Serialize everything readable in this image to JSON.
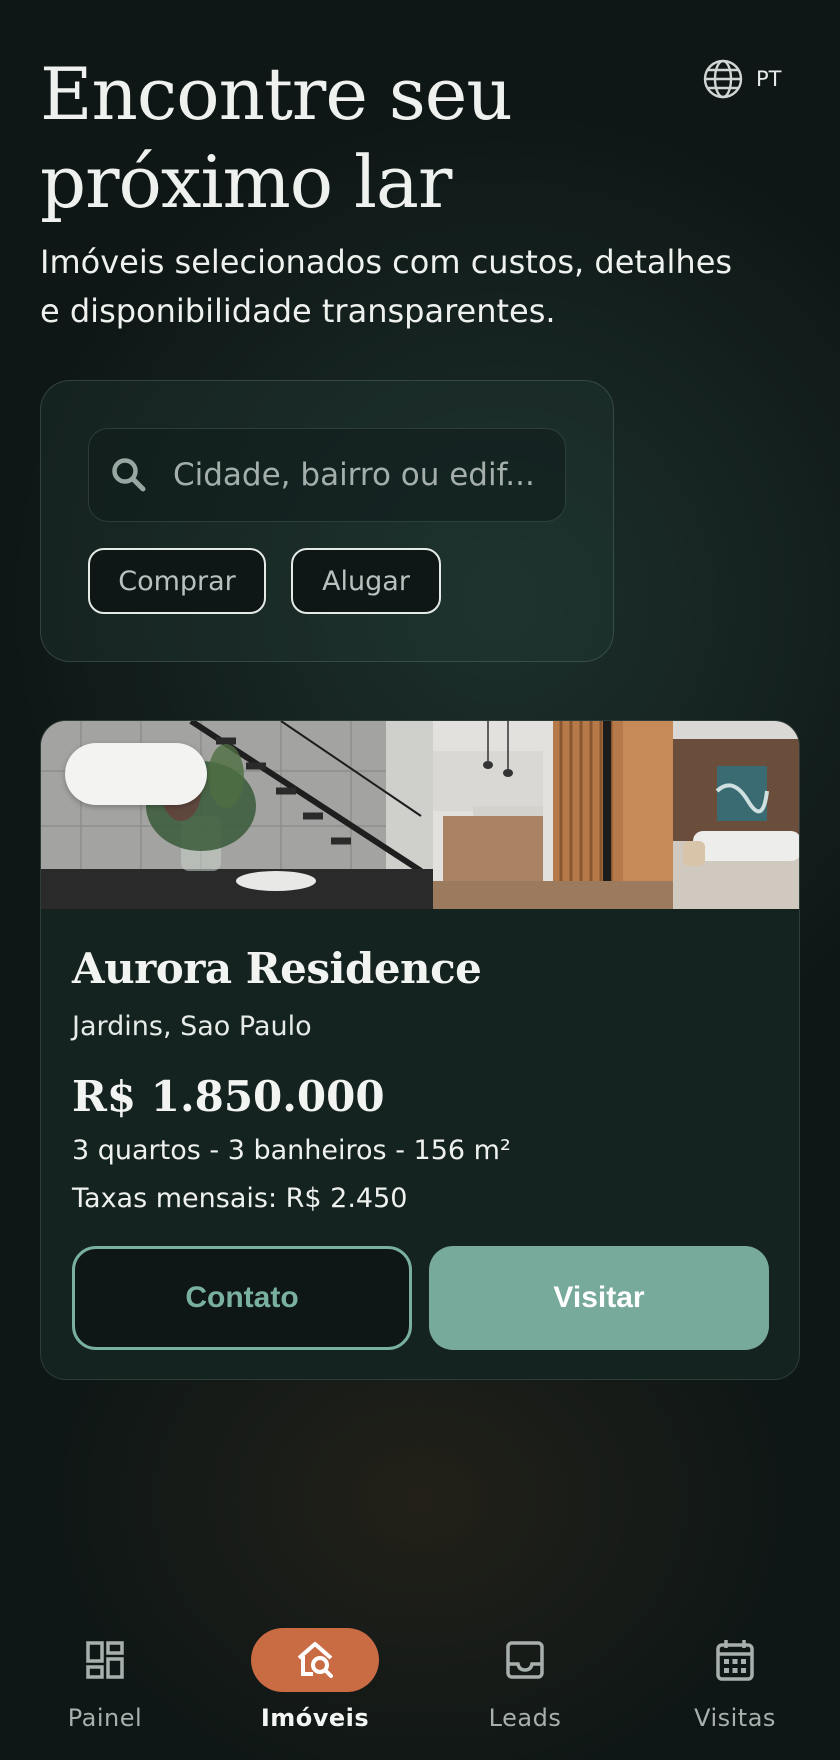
{
  "header": {
    "title": "Encontre seu próximo lar",
    "subtitle": "Imóveis selecionados com custos, detalhes e disponibilidade transparentes.",
    "language": {
      "icon": "globe-icon",
      "label": "PT"
    }
  },
  "search": {
    "placeholder": "Cidade, bairro ou edif...",
    "value": "",
    "icon": "search-icon",
    "filters": [
      {
        "label": "Comprar"
      },
      {
        "label": "Alugar"
      }
    ]
  },
  "listing": {
    "name": "Aurora Residence",
    "location": "Jardins, Sao Paulo",
    "price": "R$ 1.850.000",
    "specs": "3 quartos - 3 banheiros - 156 m²",
    "fees": "Taxas mensais: R$ 2.450",
    "actions": {
      "contact": "Contato",
      "visit": "Visitar"
    }
  },
  "bottom_nav": {
    "items": [
      {
        "label": "Painel",
        "icon": "dashboard-icon",
        "active": false
      },
      {
        "label": "Imóveis",
        "icon": "home-search-icon",
        "active": true
      },
      {
        "label": "Leads",
        "icon": "inbox-icon",
        "active": false
      },
      {
        "label": "Visitas",
        "icon": "calendar-icon",
        "active": false
      }
    ]
  },
  "colors": {
    "background": "#0f1716",
    "accent": "#78aa9c",
    "active_nav": "#c96b43",
    "card": "#142220"
  }
}
